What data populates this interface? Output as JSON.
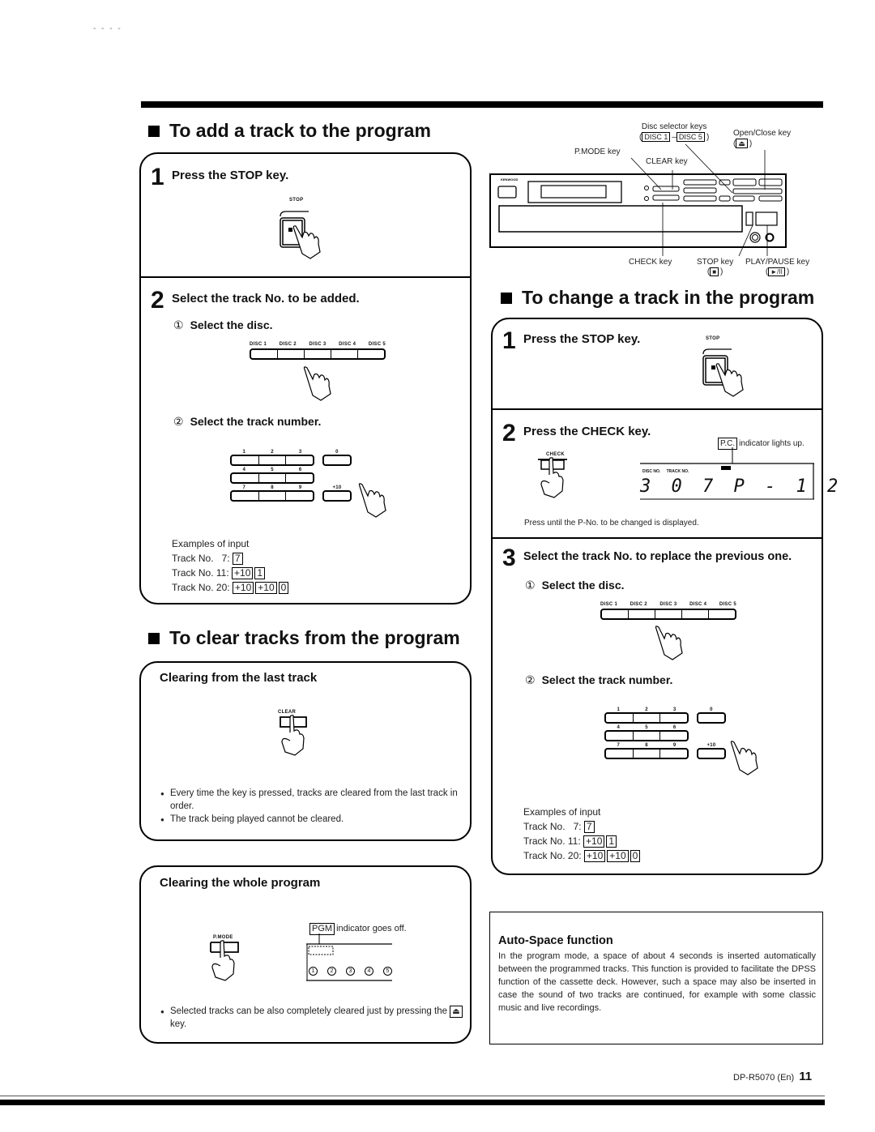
{
  "page": {
    "top_marks": "- - - -",
    "footer": {
      "model": "DP-R5070 (En)",
      "page_number": "11"
    }
  },
  "add_track": {
    "title": "To add a track to the program",
    "step1": {
      "number": "1",
      "label": "Press the STOP key.",
      "key_caption": "STOP"
    },
    "step2": {
      "number": "2",
      "label": "Select the track No. to be added.",
      "sub1": {
        "marker": "①",
        "label": "Select the disc."
      },
      "disc_keys": [
        "DISC 1",
        "DISC 2",
        "DISC 3",
        "DISC 4",
        "DISC 5"
      ],
      "sub2": {
        "marker": "②",
        "label": "Select the track number."
      },
      "keypad_rows": [
        {
          "keys": [
            "1",
            "2",
            "3"
          ],
          "extra": "0"
        },
        {
          "keys": [
            "4",
            "5",
            "6"
          ],
          "extra": ""
        },
        {
          "keys": [
            "7",
            "8",
            "9"
          ],
          "extra": "+10"
        }
      ],
      "examples_title": "Examples of input",
      "examples": [
        {
          "label": "Track No.   7:",
          "keys": [
            "7"
          ]
        },
        {
          "label": "Track No. 11:",
          "keys": [
            "+10",
            "1"
          ]
        },
        {
          "label": "Track No. 20:",
          "keys": [
            "+10",
            "+10",
            "0"
          ]
        }
      ]
    }
  },
  "player_diagram": {
    "brand": "KENWOOD",
    "callouts": {
      "disc_selector": "Disc selector keys",
      "disc_selector_range": [
        "DISC 1",
        "DISC 5"
      ],
      "open_close": "Open/Close key",
      "open_close_symbol": "⏏",
      "pmode": "P.MODE key",
      "clear": "CLEAR key",
      "check": "CHECK key",
      "stop": "STOP key",
      "stop_symbol": "■",
      "play_pause": "PLAY/PAUSE key",
      "play_pause_symbol": "►/II"
    }
  },
  "change_track": {
    "title": "To change a track in the program",
    "step1": {
      "number": "1",
      "label": "Press the STOP key.",
      "key_caption": "STOP"
    },
    "step2": {
      "number": "2",
      "label": "Press the CHECK key.",
      "key_caption": "CHECK",
      "indicator": "P.C.",
      "indicator_text": "indicator lights up.",
      "display": {
        "disc_label": "DISC NO.",
        "track_label": "TRACK NO.",
        "digits": "3 0 7  P -  1 2"
      },
      "note": "Press until the P-No. to be changed is displayed."
    },
    "step3": {
      "number": "3",
      "label": "Select the track No. to replace the previous one.",
      "sub1": {
        "marker": "①",
        "label": "Select the disc."
      },
      "disc_keys": [
        "DISC 1",
        "DISC 2",
        "DISC 3",
        "DISC 4",
        "DISC 5"
      ],
      "sub2": {
        "marker": "②",
        "label": "Select the track number."
      },
      "keypad_rows": [
        {
          "keys": [
            "1",
            "2",
            "3"
          ],
          "extra": "0"
        },
        {
          "keys": [
            "4",
            "5",
            "6"
          ],
          "extra": ""
        },
        {
          "keys": [
            "7",
            "8",
            "9"
          ],
          "extra": "+10"
        }
      ],
      "examples_title": "Examples of input",
      "examples": [
        {
          "label": "Track No.   7:",
          "keys": [
            "7"
          ]
        },
        {
          "label": "Track No. 11:",
          "keys": [
            "+10",
            "1"
          ]
        },
        {
          "label": "Track No. 20:",
          "keys": [
            "+10",
            "+10",
            "0"
          ]
        }
      ]
    }
  },
  "clear_tracks": {
    "title": "To clear tracks from the program",
    "last_track": {
      "heading": "Clearing from the last track",
      "key_caption": "CLEAR",
      "bullets": [
        "Every time the key is pressed, tracks are cleared from the last track in order.",
        "The track being played cannot be cleared."
      ]
    },
    "whole_program": {
      "heading": "Clearing the whole program",
      "key_caption": "P.MODE",
      "indicator": "PGM",
      "indicator_text": "indicator goes off.",
      "disc_circles": [
        "1",
        "2",
        "3",
        "4",
        "5"
      ],
      "bullet_pre": "Selected tracks can be also completely cleared just by pressing the",
      "bullet_key": "⏏",
      "bullet_post": "key."
    }
  },
  "auto_space": {
    "title": "Auto-Space function",
    "body": "In the program mode, a space of about 4 seconds is inserted automatically between the programmed tracks. This function is provided to facilitate the DPSS function of the cassette deck. However, such a space may also be inserted in case the sound of two tracks are continued, for example with some classic music and live recordings."
  }
}
